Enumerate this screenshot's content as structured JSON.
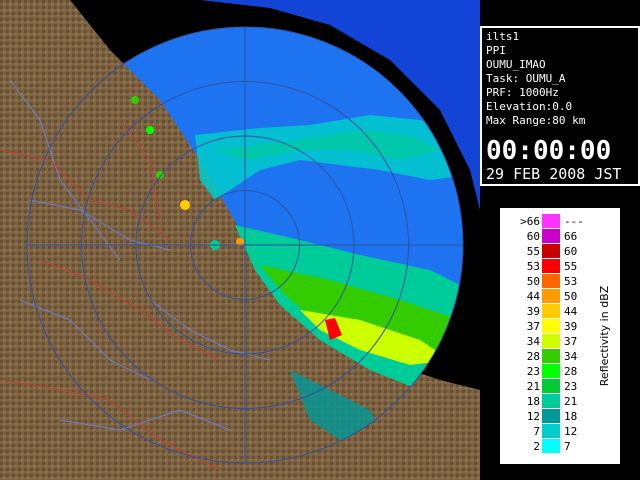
{
  "info": {
    "lines": [
      "ilts1",
      "PPI",
      "OUMU_IMAO",
      "Task: OUMU_A",
      "PRF: 1000Hz",
      "Elevation:0.0",
      "Max Range:80 km"
    ],
    "time": "00:00:00",
    "date": "29 FEB 2008 JST"
  },
  "legend": {
    "title": "Reflectivity in dBZ",
    "rows": [
      {
        "min": ">66",
        "max": "---",
        "color": "#ff33ff"
      },
      {
        "min": "60",
        "max": "66",
        "color": "#cc00cc"
      },
      {
        "min": "55",
        "max": "60",
        "color": "#c80000"
      },
      {
        "min": "53",
        "max": "55",
        "color": "#ff0000"
      },
      {
        "min": "50",
        "max": "53",
        "color": "#ff6600"
      },
      {
        "min": "44",
        "max": "50",
        "color": "#ff9900"
      },
      {
        "min": "39",
        "max": "44",
        "color": "#ffcc00"
      },
      {
        "min": "37",
        "max": "39",
        "color": "#ffff00"
      },
      {
        "min": "34",
        "max": "37",
        "color": "#ccff00"
      },
      {
        "min": "28",
        "max": "34",
        "color": "#33cc00"
      },
      {
        "min": "23",
        "max": "28",
        "color": "#00ff00"
      },
      {
        "min": "21",
        "max": "23",
        "color": "#00cc33"
      },
      {
        "min": "18",
        "max": "21",
        "color": "#00cc99"
      },
      {
        "min": "12",
        "max": "18",
        "color": "#009999"
      },
      {
        "min": "7",
        "max": "12",
        "color": "#00cccc"
      },
      {
        "min": "2",
        "max": "7",
        "color": "#00ffff"
      }
    ]
  },
  "map": {
    "range_rings_km": [
      20,
      40,
      60,
      80
    ],
    "colors": {
      "background": "#000000",
      "sea_coverage": "#1e74f0",
      "sea_outside": "#1244d8",
      "land": "#8a6d48",
      "land_dark": "#5a4630",
      "rivers": "#6a7fd0",
      "boundaries": "#c04030",
      "rings": "#3050a0"
    }
  }
}
